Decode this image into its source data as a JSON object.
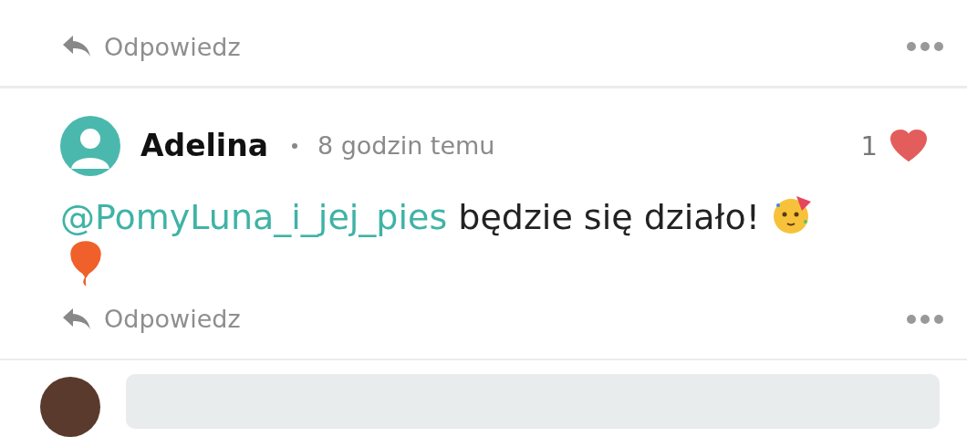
{
  "previous_comment": {
    "reply_label": "Odpowiedz"
  },
  "comment": {
    "author": "Adelina",
    "time": "8 godzin temu",
    "likes": "1",
    "liked": true,
    "mention": "@PomyLuna_i_jej_pies",
    "text": "będzie się działo!",
    "reply_label": "Odpowiedz"
  }
}
